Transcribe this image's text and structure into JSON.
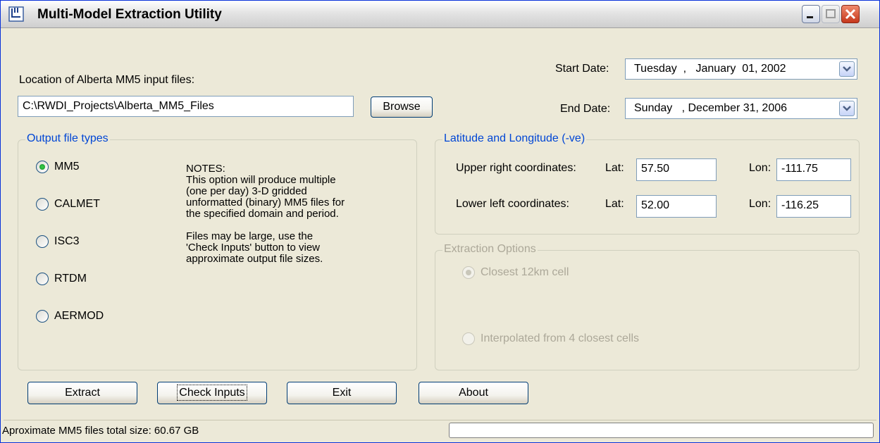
{
  "window": {
    "title": "Multi-Model Extraction Utility"
  },
  "input_location": {
    "label": "Location of Alberta MM5 input files:",
    "path": "C:\\RWDI_Projects\\Alberta_MM5_Files",
    "browse_label": "Browse"
  },
  "dates": {
    "start_label": "Start Date:",
    "start_value": "Tuesday  ,   January  01, 2002",
    "end_label": "End Date:",
    "end_value": "Sunday   , December 31, 2006"
  },
  "output_types": {
    "title": "Output file types",
    "options": [
      "MM5",
      "CALMET",
      "ISC3",
      "RTDM",
      "AERMOD"
    ],
    "selected": "MM5",
    "notes": "NOTES:\nThis option will produce multiple\n(one per day) 3-D gridded\nunformatted (binary) MM5 files for\nthe specified domain and period.\n\nFiles may be large, use the\n'Check Inputs' button to view\napproximate output file sizes."
  },
  "coordinates": {
    "title": "Latitude and Longitude (-ve)",
    "upper_label": "Upper right coordinates:",
    "lower_label": "Lower left coordinates:",
    "lat_label": "Lat:",
    "lon_label": "Lon:",
    "upper_lat": "57.50",
    "upper_lon": "-111.75",
    "lower_lat": "52.00",
    "lower_lon": "-116.25"
  },
  "extraction": {
    "title": "Extraction Options",
    "option_closest": "Closest 12km cell",
    "option_interpolated": "Interpolated from 4 closest cells",
    "selected": "closest",
    "enabled": false
  },
  "buttons": {
    "extract": "Extract",
    "check_inputs": "Check Inputs",
    "exit": "Exit",
    "about": "About"
  },
  "status": {
    "text": "Aproximate MM5 files total size: 60.67 GB",
    "progress": 0
  }
}
